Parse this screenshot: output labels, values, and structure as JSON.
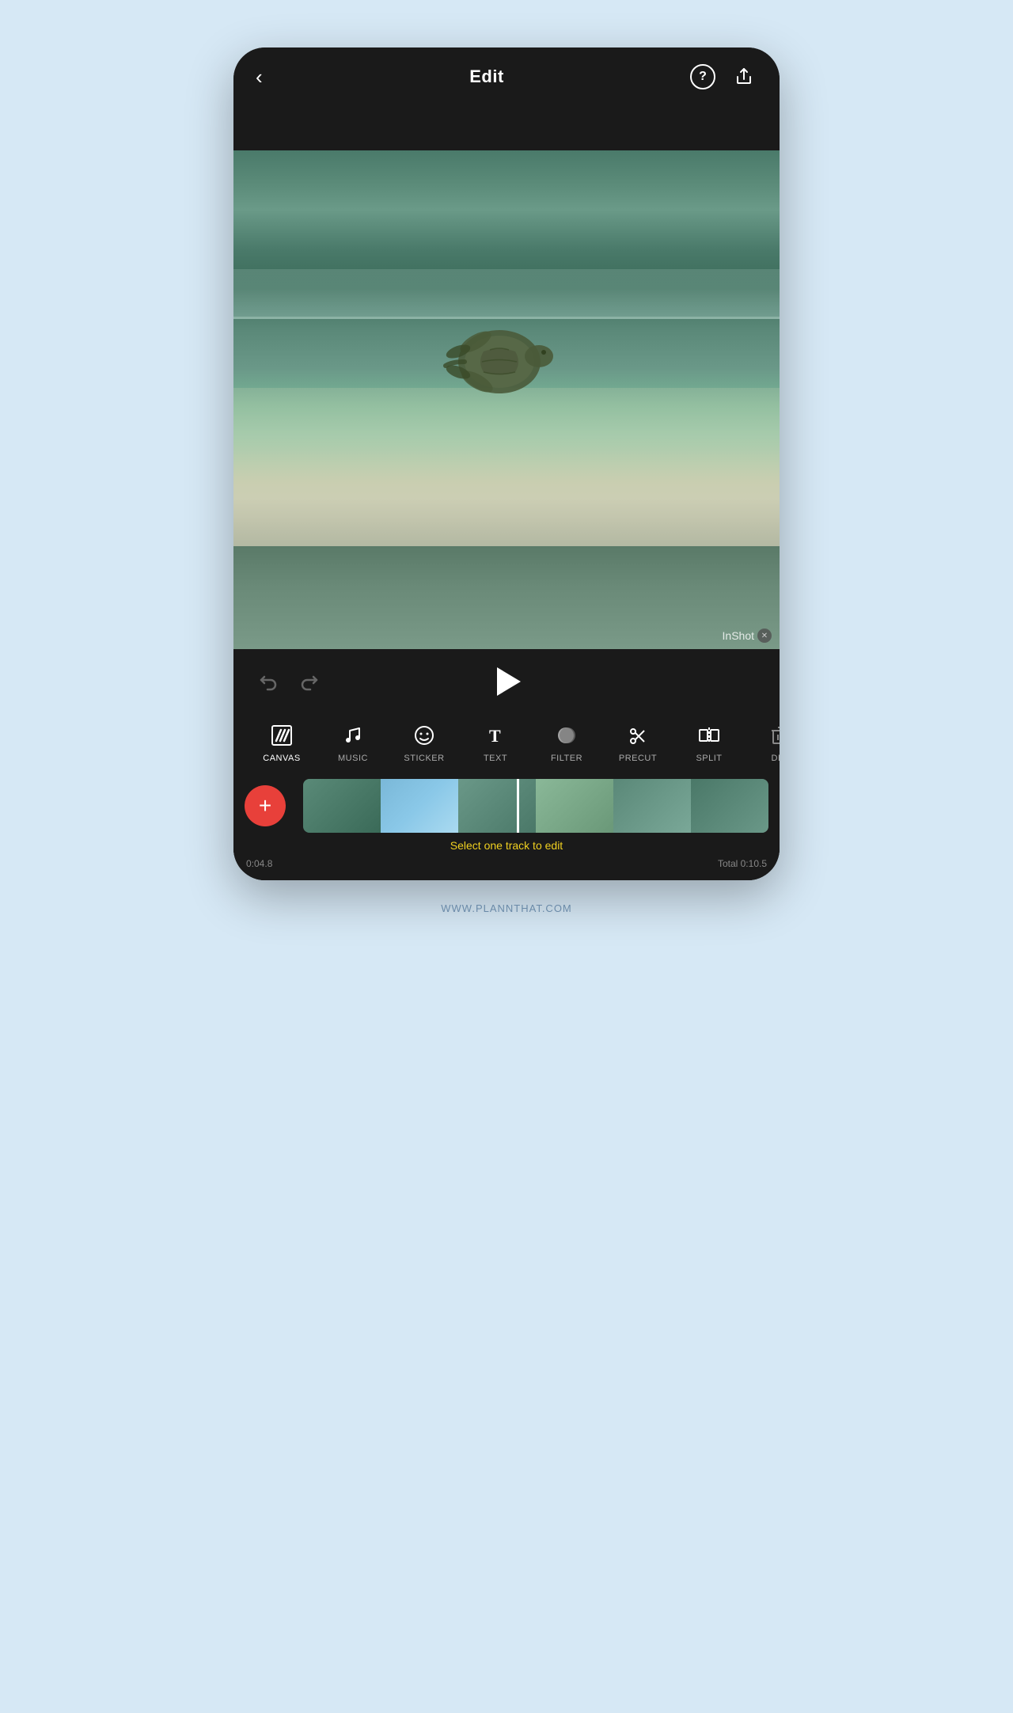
{
  "header": {
    "title": "Edit",
    "back_label": "‹",
    "help_label": "?",
    "share_label": "⬆"
  },
  "video": {
    "watermark": "InShot"
  },
  "controls": {
    "undo_label": "↩",
    "redo_label": "↪"
  },
  "tools": [
    {
      "id": "canvas",
      "label": "CANVAS",
      "icon": "slash",
      "active": true
    },
    {
      "id": "music",
      "label": "MUSIC",
      "icon": "music"
    },
    {
      "id": "sticker",
      "label": "STICKER",
      "icon": "sticker"
    },
    {
      "id": "text",
      "label": "TEXT",
      "icon": "text"
    },
    {
      "id": "filter",
      "label": "FILTER",
      "icon": "filter"
    },
    {
      "id": "precut",
      "label": "PRECUT",
      "icon": "precut"
    },
    {
      "id": "split",
      "label": "SPLIT",
      "icon": "split"
    },
    {
      "id": "delete",
      "label": "DEL",
      "icon": "delete"
    }
  ],
  "timeline": {
    "add_button_label": "+",
    "select_message": "Select one track to edit",
    "current_time": "0:04.8",
    "total_time": "Total 0:10.5"
  },
  "footer": {
    "website": "WWW.PLANNTHAT.COM"
  }
}
